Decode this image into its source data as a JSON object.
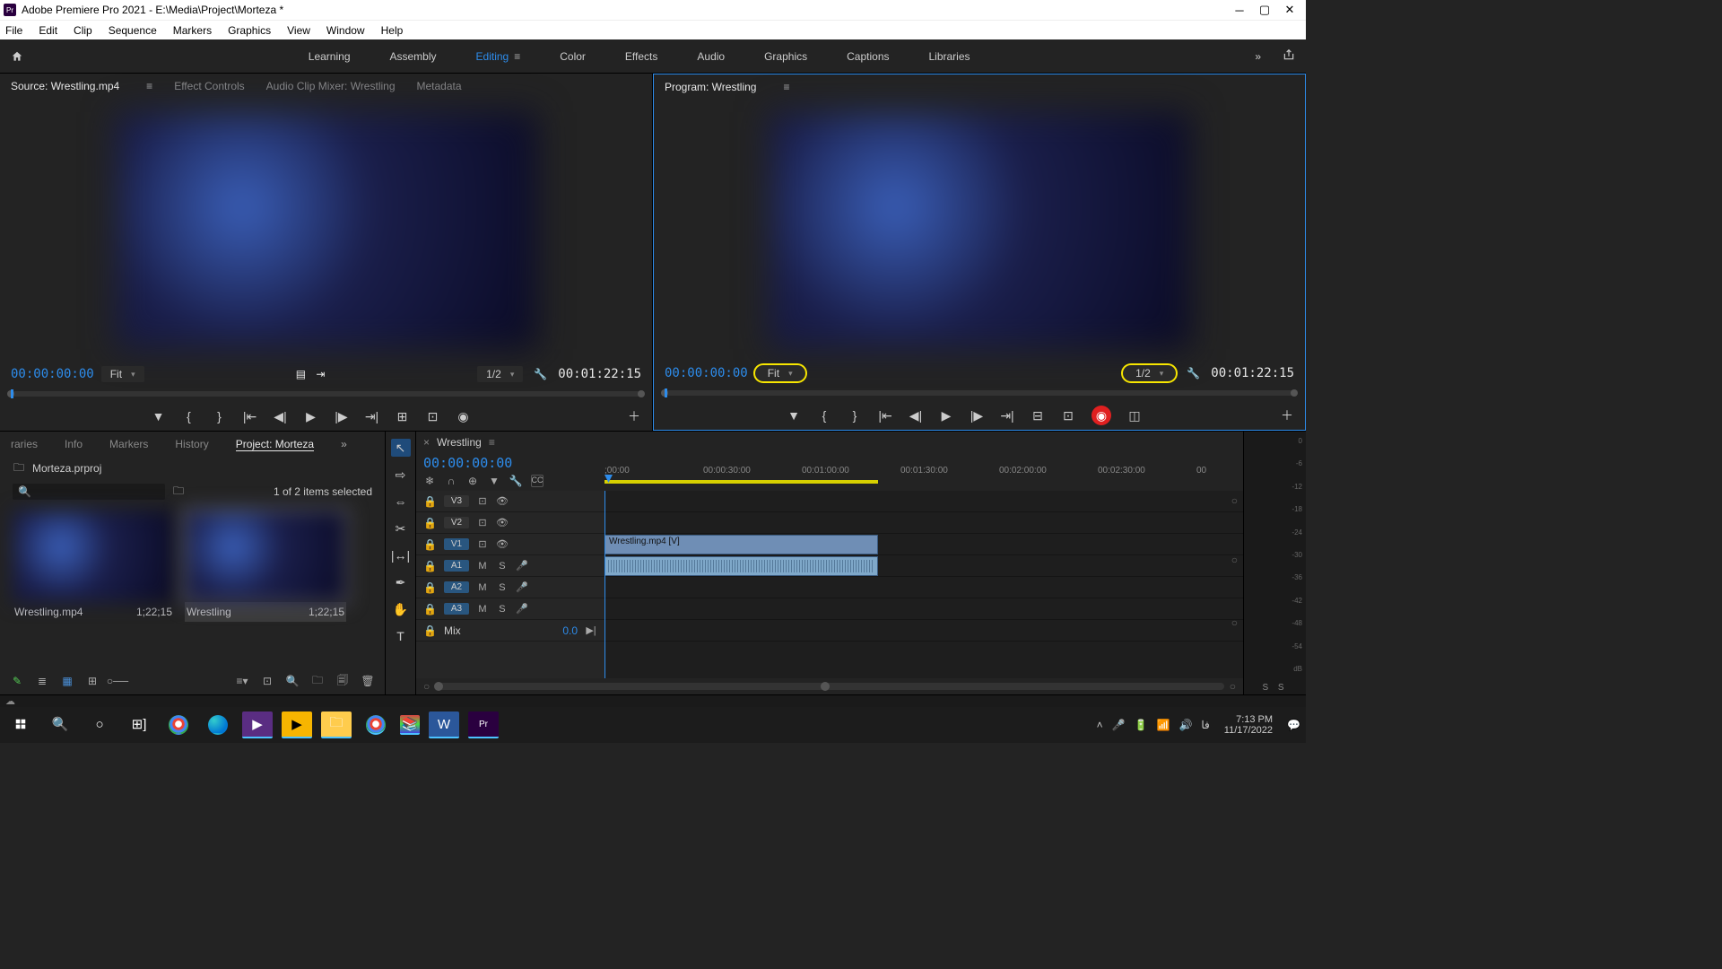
{
  "title": "Adobe Premiere Pro 2021 - E:\\Media\\Project\\Morteza *",
  "menus": [
    "File",
    "Edit",
    "Clip",
    "Sequence",
    "Markers",
    "Graphics",
    "View",
    "Window",
    "Help"
  ],
  "workspaces": [
    "Learning",
    "Assembly",
    "Editing",
    "Color",
    "Effects",
    "Audio",
    "Graphics",
    "Captions",
    "Libraries"
  ],
  "workspace_active": "Editing",
  "source": {
    "tabs": [
      "Source: Wrestling.mp4",
      "Effect Controls",
      "Audio Clip Mixer: Wrestling",
      "Metadata"
    ],
    "tc_in": "00:00:00:00",
    "fit": "Fit",
    "res": "1/2",
    "tc_out": "00:01:22:15"
  },
  "program": {
    "title": "Program: Wrestling",
    "tc_in": "00:00:00:00",
    "fit": "Fit",
    "res": "1/2",
    "tc_out": "00:01:22:15"
  },
  "project": {
    "tabs_left": [
      "raries",
      "Info",
      "Markers",
      "History"
    ],
    "tab_active": "Project: Morteza",
    "file": "Morteza.prproj",
    "selection": "1 of 2 items selected",
    "bins": [
      {
        "name": "Wrestling.mp4",
        "dur": "1;22;15"
      },
      {
        "name": "Wrestling",
        "dur": "1;22;15"
      }
    ]
  },
  "timeline": {
    "seq": "Wrestling",
    "tc": "00:00:00:00",
    "ticks": [
      ";00:00",
      "00:00:30:00",
      "00:01:00:00",
      "00:01:30:00",
      "00:02:00:00",
      "00:02:30:00",
      "00"
    ],
    "tracks_v": [
      "V3",
      "V2",
      "V1"
    ],
    "tracks_a": [
      "A1",
      "A2",
      "A3"
    ],
    "mix": "Mix",
    "mix_val": "0.0",
    "clip_v": "Wrestling.mp4 [V]"
  },
  "meter_scale": [
    "0",
    "-6",
    "-12",
    "-18",
    "-24",
    "-30",
    "-36",
    "-42",
    "-48",
    "-54",
    "dB"
  ],
  "tray": {
    "lang": "فا",
    "time": "7:13 PM",
    "date": "11/17/2022"
  }
}
